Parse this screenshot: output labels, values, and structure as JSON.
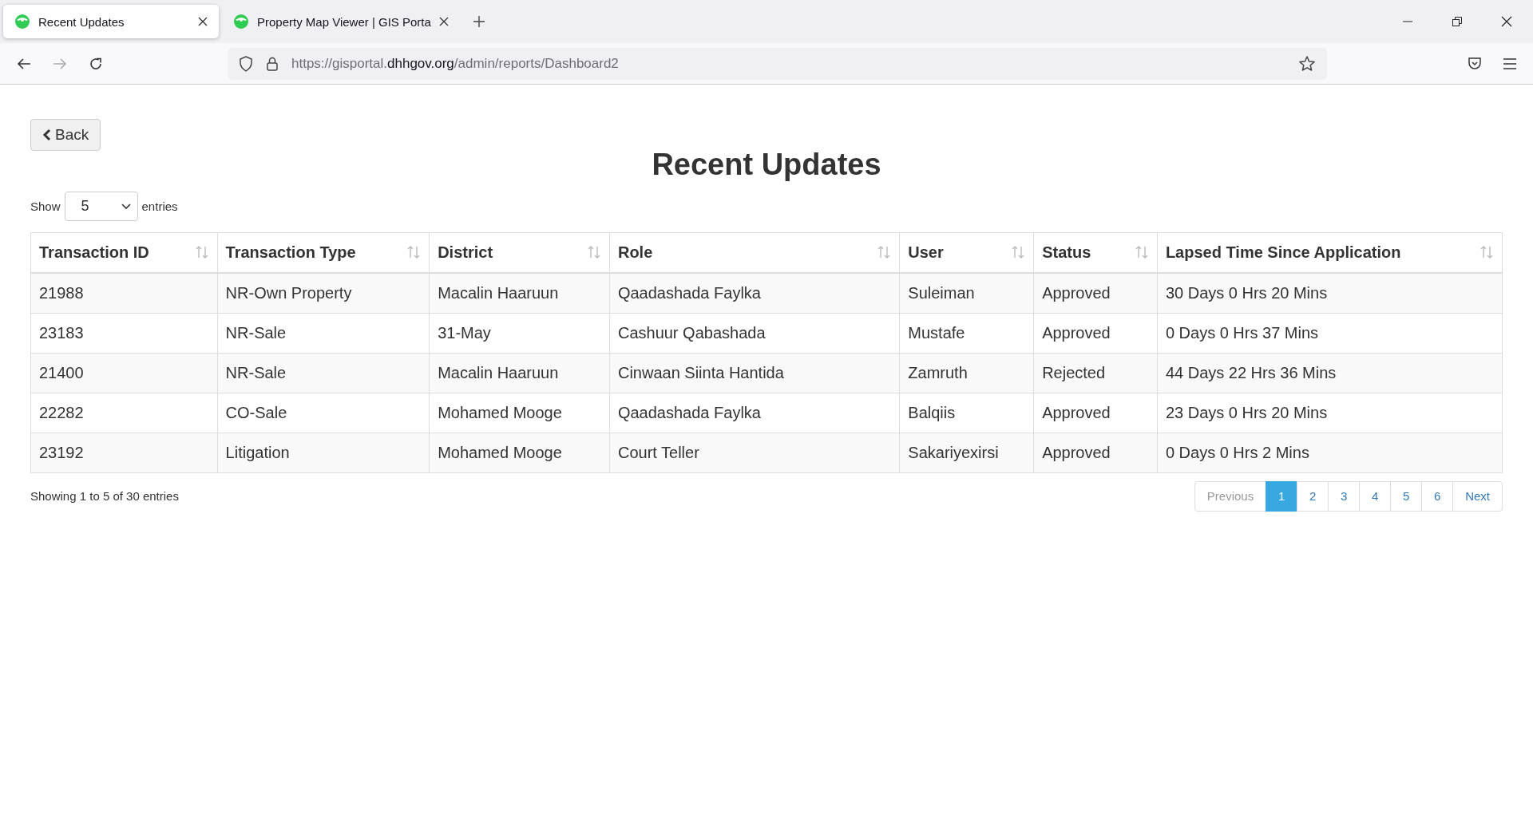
{
  "browser": {
    "tabs": [
      {
        "title": "Recent Updates",
        "selected": true
      },
      {
        "title": "Property Map Viewer | GIS Porta",
        "selected": false
      }
    ],
    "url": {
      "prefix": "https://gisportal.",
      "domain": "dhhgov.org",
      "path": "/admin/reports/Dashboard2"
    }
  },
  "page": {
    "back_label": "Back",
    "title": "Recent Updates",
    "show_label": "Show",
    "entries_value": "5",
    "entries_label": "entries"
  },
  "table": {
    "columns": [
      "Transaction ID",
      "Transaction Type",
      "District",
      "Role",
      "User",
      "Status",
      "Lapsed Time Since Application"
    ],
    "rows": [
      [
        "21988",
        "NR-Own Property",
        "Macalin Haaruun",
        "Qaadashada Faylka",
        "Suleiman",
        "Approved",
        "30 Days 0 Hrs 20 Mins"
      ],
      [
        "23183",
        "NR-Sale",
        "31-May",
        "Cashuur Qabashada",
        "Mustafe",
        "Approved",
        "0 Days 0 Hrs 37 Mins"
      ],
      [
        "21400",
        "NR-Sale",
        "Macalin Haaruun",
        "Cinwaan Siinta Hantida",
        "Zamruth",
        "Rejected",
        "44 Days 22 Hrs 36 Mins"
      ],
      [
        "22282",
        "CO-Sale",
        "Mohamed Mooge",
        "Qaadashada Faylka",
        "Balqiis",
        "Approved",
        "23 Days 0 Hrs 20 Mins"
      ],
      [
        "23192",
        "Litigation",
        "Mohamed Mooge",
        "Court Teller",
        "Sakariyexirsi",
        "Approved",
        "0 Days 0 Hrs 2 Mins"
      ]
    ]
  },
  "footer": {
    "info": "Showing 1 to 5 of 30 entries",
    "pagination": [
      {
        "label": "Previous",
        "selected": false,
        "disabled": true
      },
      {
        "label": "1",
        "selected": true,
        "disabled": false
      },
      {
        "label": "2",
        "selected": false,
        "disabled": false
      },
      {
        "label": "3",
        "selected": false,
        "disabled": false
      },
      {
        "label": "4",
        "selected": false,
        "disabled": false
      },
      {
        "label": "5",
        "selected": false,
        "disabled": false
      },
      {
        "label": "6",
        "selected": false,
        "disabled": false
      },
      {
        "label": "Next",
        "selected": false,
        "disabled": false
      }
    ]
  }
}
